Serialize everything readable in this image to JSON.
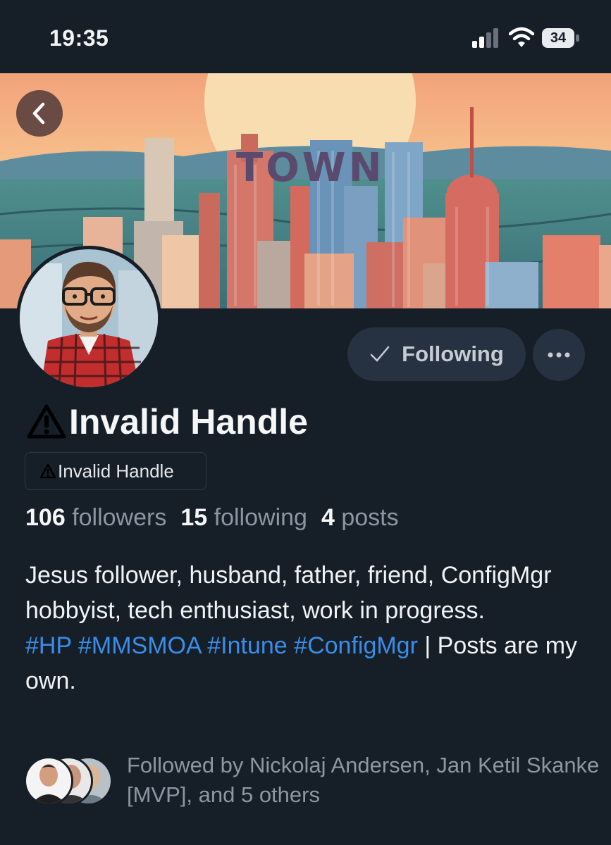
{
  "status_bar": {
    "time": "19:35",
    "battery": "34"
  },
  "banner": {
    "text": "TOWN"
  },
  "actions": {
    "follow_label": "Following"
  },
  "profile": {
    "display_name": "Invalid Handle",
    "handle": "Invalid Handle"
  },
  "stats": {
    "followers_count": "106",
    "followers_label": "followers",
    "following_count": "15",
    "following_label": "following",
    "posts_count": "4",
    "posts_label": "posts"
  },
  "bio": {
    "text": "Jesus follower, husband, father, friend, ConfigMgr hobbyist, tech enthusiast, work in progress.",
    "tags": [
      "#HP",
      "#MMSMOA",
      "#Intune",
      "#ConfigMgr"
    ],
    "suffix": "| Posts are my own."
  },
  "followed_by": {
    "text": "Followed by Nickolaj Andersen, Jan Ketil Skanke [MVP], and 5 others"
  },
  "colors": {
    "background": "#161e27",
    "button_bg": "#263241",
    "hashtag": "#3a8ee8",
    "muted": "#8d96a2"
  }
}
